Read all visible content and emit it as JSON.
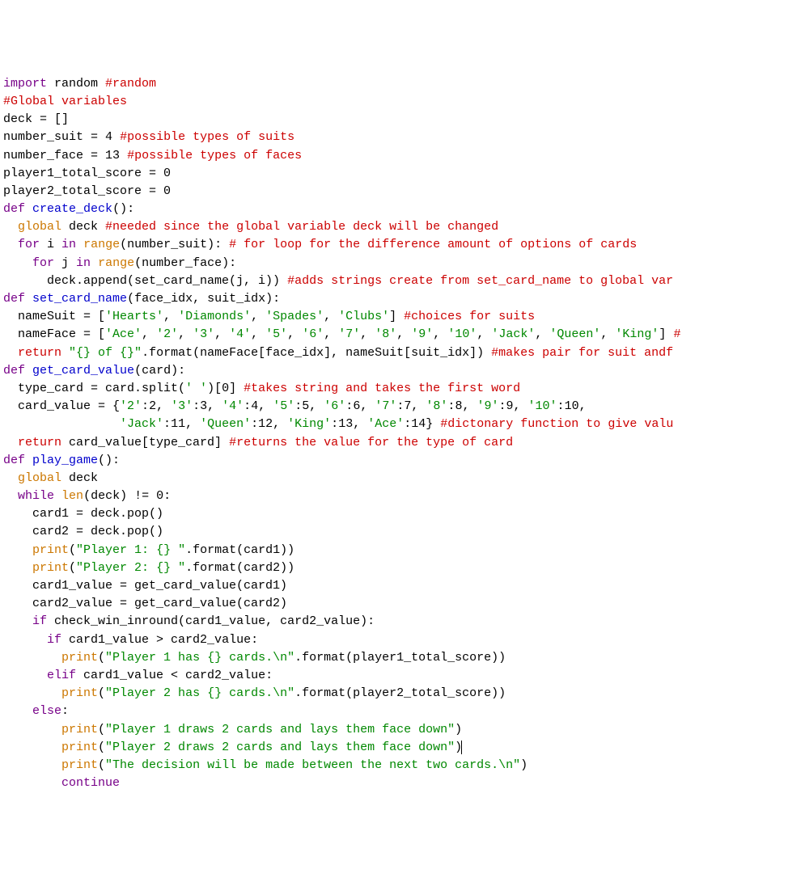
{
  "code_lines": [
    [
      [
        "import",
        "k"
      ],
      [
        " random ",
        "n"
      ],
      [
        "#random",
        "c"
      ]
    ],
    [
      [
        "#Global variables",
        "c"
      ]
    ],
    [
      [
        "deck = []",
        "n"
      ]
    ],
    [
      [
        "number_suit = ",
        "n"
      ],
      [
        "4",
        "num"
      ],
      [
        " ",
        "n"
      ],
      [
        "#possible types of suits",
        "c"
      ]
    ],
    [
      [
        "number_face = ",
        "n"
      ],
      [
        "13",
        "num"
      ],
      [
        " ",
        "n"
      ],
      [
        "#possible types of faces",
        "c"
      ]
    ],
    [
      [
        "player1_total_score = ",
        "n"
      ],
      [
        "0",
        "num"
      ]
    ],
    [
      [
        "player2_total_score = ",
        "n"
      ],
      [
        "0",
        "num"
      ]
    ],
    [
      [
        "",
        "n"
      ]
    ],
    [
      [
        "def",
        "kd"
      ],
      [
        " ",
        "n"
      ],
      [
        "create_deck",
        "fn"
      ],
      [
        "():",
        "n"
      ]
    ],
    [
      [
        "  ",
        "n"
      ],
      [
        "global",
        "bi"
      ],
      [
        " deck ",
        "n"
      ],
      [
        "#needed since the global variable deck will be changed",
        "c"
      ]
    ],
    [
      [
        "  ",
        "n"
      ],
      [
        "for",
        "k"
      ],
      [
        " i ",
        "n"
      ],
      [
        "in",
        "k"
      ],
      [
        " ",
        "n"
      ],
      [
        "range",
        "bi"
      ],
      [
        "(number_suit): ",
        "n"
      ],
      [
        "# for loop for the difference amount of options of cards",
        "c"
      ]
    ],
    [
      [
        "    ",
        "n"
      ],
      [
        "for",
        "k"
      ],
      [
        " j ",
        "n"
      ],
      [
        "in",
        "k"
      ],
      [
        " ",
        "n"
      ],
      [
        "range",
        "bi"
      ],
      [
        "(number_face):",
        "n"
      ]
    ],
    [
      [
        "      deck.append(set_card_name(j, i)) ",
        "n"
      ],
      [
        "#adds strings create from set_card_name to global var",
        "c"
      ]
    ],
    [
      [
        "",
        "n"
      ]
    ],
    [
      [
        "def",
        "kd"
      ],
      [
        " ",
        "n"
      ],
      [
        "set_card_name",
        "fn"
      ],
      [
        "(face_idx, suit_idx):",
        "n"
      ]
    ],
    [
      [
        "  nameSuit = [",
        "n"
      ],
      [
        "'Hearts'",
        "s"
      ],
      [
        ", ",
        "n"
      ],
      [
        "'Diamonds'",
        "s"
      ],
      [
        ", ",
        "n"
      ],
      [
        "'Spades'",
        "s"
      ],
      [
        ", ",
        "n"
      ],
      [
        "'Clubs'",
        "s"
      ],
      [
        "] ",
        "n"
      ],
      [
        "#choices for suits",
        "c"
      ]
    ],
    [
      [
        "  nameFace = [",
        "n"
      ],
      [
        "'Ace'",
        "s"
      ],
      [
        ", ",
        "n"
      ],
      [
        "'2'",
        "s"
      ],
      [
        ", ",
        "n"
      ],
      [
        "'3'",
        "s"
      ],
      [
        ", ",
        "n"
      ],
      [
        "'4'",
        "s"
      ],
      [
        ", ",
        "n"
      ],
      [
        "'5'",
        "s"
      ],
      [
        ", ",
        "n"
      ],
      [
        "'6'",
        "s"
      ],
      [
        ", ",
        "n"
      ],
      [
        "'7'",
        "s"
      ],
      [
        ", ",
        "n"
      ],
      [
        "'8'",
        "s"
      ],
      [
        ", ",
        "n"
      ],
      [
        "'9'",
        "s"
      ],
      [
        ", ",
        "n"
      ],
      [
        "'10'",
        "s"
      ],
      [
        ", ",
        "n"
      ],
      [
        "'Jack'",
        "s"
      ],
      [
        ", ",
        "n"
      ],
      [
        "'Queen'",
        "s"
      ],
      [
        ", ",
        "n"
      ],
      [
        "'King'",
        "s"
      ],
      [
        "] ",
        "n"
      ],
      [
        "#",
        "c"
      ]
    ],
    [
      [
        "  ",
        "n"
      ],
      [
        "return",
        "kr"
      ],
      [
        " ",
        "n"
      ],
      [
        "\"{} of {}\"",
        "s"
      ],
      [
        ".format(nameFace[face_idx], nameSuit[suit_idx]) ",
        "n"
      ],
      [
        "#makes pair for suit andf",
        "c"
      ]
    ],
    [
      [
        "",
        "n"
      ]
    ],
    [
      [
        "def",
        "kd"
      ],
      [
        " ",
        "n"
      ],
      [
        "get_card_value",
        "fn"
      ],
      [
        "(card):",
        "n"
      ]
    ],
    [
      [
        "  type_card = card.split(",
        "n"
      ],
      [
        "' '",
        "s"
      ],
      [
        ")[",
        "n"
      ],
      [
        "0",
        "num"
      ],
      [
        "] ",
        "n"
      ],
      [
        "#takes string and takes the first word",
        "c"
      ]
    ],
    [
      [
        "  card_value = {",
        "n"
      ],
      [
        "'2'",
        "s"
      ],
      [
        ":",
        "n"
      ],
      [
        "2",
        "num"
      ],
      [
        ", ",
        "n"
      ],
      [
        "'3'",
        "s"
      ],
      [
        ":",
        "n"
      ],
      [
        "3",
        "num"
      ],
      [
        ", ",
        "n"
      ],
      [
        "'4'",
        "s"
      ],
      [
        ":",
        "n"
      ],
      [
        "4",
        "num"
      ],
      [
        ", ",
        "n"
      ],
      [
        "'5'",
        "s"
      ],
      [
        ":",
        "n"
      ],
      [
        "5",
        "num"
      ],
      [
        ", ",
        "n"
      ],
      [
        "'6'",
        "s"
      ],
      [
        ":",
        "n"
      ],
      [
        "6",
        "num"
      ],
      [
        ", ",
        "n"
      ],
      [
        "'7'",
        "s"
      ],
      [
        ":",
        "n"
      ],
      [
        "7",
        "num"
      ],
      [
        ", ",
        "n"
      ],
      [
        "'8'",
        "s"
      ],
      [
        ":",
        "n"
      ],
      [
        "8",
        "num"
      ],
      [
        ", ",
        "n"
      ],
      [
        "'9'",
        "s"
      ],
      [
        ":",
        "n"
      ],
      [
        "9",
        "num"
      ],
      [
        ", ",
        "n"
      ],
      [
        "'10'",
        "s"
      ],
      [
        ":",
        "n"
      ],
      [
        "10",
        "num"
      ],
      [
        ",",
        "n"
      ]
    ],
    [
      [
        "                ",
        "n"
      ],
      [
        "'Jack'",
        "s"
      ],
      [
        ":",
        "n"
      ],
      [
        "11",
        "num"
      ],
      [
        ", ",
        "n"
      ],
      [
        "'Queen'",
        "s"
      ],
      [
        ":",
        "n"
      ],
      [
        "12",
        "num"
      ],
      [
        ", ",
        "n"
      ],
      [
        "'King'",
        "s"
      ],
      [
        ":",
        "n"
      ],
      [
        "13",
        "num"
      ],
      [
        ", ",
        "n"
      ],
      [
        "'Ace'",
        "s"
      ],
      [
        ":",
        "n"
      ],
      [
        "14",
        "num"
      ],
      [
        "} ",
        "n"
      ],
      [
        "#dictonary function to give valu",
        "c"
      ]
    ],
    [
      [
        "  ",
        "n"
      ],
      [
        "return",
        "kr"
      ],
      [
        " card_value[type_card] ",
        "n"
      ],
      [
        "#returns the value for the type of card",
        "c"
      ]
    ],
    [
      [
        "",
        "n"
      ]
    ],
    [
      [
        "def",
        "kd"
      ],
      [
        " ",
        "n"
      ],
      [
        "play_game",
        "fn"
      ],
      [
        "():",
        "n"
      ]
    ],
    [
      [
        "  ",
        "n"
      ],
      [
        "global",
        "bi"
      ],
      [
        " deck",
        "n"
      ]
    ],
    [
      [
        "  ",
        "n"
      ],
      [
        "while",
        "k"
      ],
      [
        " ",
        "n"
      ],
      [
        "len",
        "bi"
      ],
      [
        "(deck) != ",
        "n"
      ],
      [
        "0",
        "num"
      ],
      [
        ":",
        "n"
      ]
    ],
    [
      [
        "    card1 = deck.pop()",
        "n"
      ]
    ],
    [
      [
        "    card2 = deck.pop()",
        "n"
      ]
    ],
    [
      [
        "    ",
        "n"
      ],
      [
        "print",
        "bi"
      ],
      [
        "(",
        "n"
      ],
      [
        "\"Player 1: {} \"",
        "s"
      ],
      [
        ".format(card1))",
        "n"
      ]
    ],
    [
      [
        "    ",
        "n"
      ],
      [
        "print",
        "bi"
      ],
      [
        "(",
        "n"
      ],
      [
        "\"Player 2: {} \"",
        "s"
      ],
      [
        ".format(card2))",
        "n"
      ]
    ],
    [
      [
        "    card1_value = get_card_value(card1)",
        "n"
      ]
    ],
    [
      [
        "    card2_value = get_card_value(card2)",
        "n"
      ]
    ],
    [
      [
        "    ",
        "n"
      ],
      [
        "if",
        "k"
      ],
      [
        " check_win_inround(card1_value, card2_value):",
        "n"
      ]
    ],
    [
      [
        "      ",
        "n"
      ],
      [
        "if",
        "k"
      ],
      [
        " card1_value > card2_value:",
        "n"
      ]
    ],
    [
      [
        "        ",
        "n"
      ],
      [
        "print",
        "bi"
      ],
      [
        "(",
        "n"
      ],
      [
        "\"Player 1 has {} cards.\\n\"",
        "s"
      ],
      [
        ".format(player1_total_score))",
        "n"
      ]
    ],
    [
      [
        "      ",
        "n"
      ],
      [
        "elif",
        "k"
      ],
      [
        " card1_value < card2_value:",
        "n"
      ]
    ],
    [
      [
        "        ",
        "n"
      ],
      [
        "print",
        "bi"
      ],
      [
        "(",
        "n"
      ],
      [
        "\"Player 2 has {} cards.\\n\"",
        "s"
      ],
      [
        ".format(player2_total_score))",
        "n"
      ]
    ],
    [
      [
        "    ",
        "n"
      ],
      [
        "else",
        "k"
      ],
      [
        ":",
        "n"
      ]
    ],
    [
      [
        "        ",
        "n"
      ],
      [
        "print",
        "bi"
      ],
      [
        "(",
        "n"
      ],
      [
        "\"Player 1 draws 2 cards and lays them face down\"",
        "s"
      ],
      [
        ")",
        "n"
      ]
    ],
    [
      [
        "        ",
        "n"
      ],
      [
        "print",
        "bi"
      ],
      [
        "(",
        "n"
      ],
      [
        "\"Player 2 draws 2 cards and lays them face down\"",
        "s"
      ],
      [
        ")",
        "n"
      ],
      [
        "|",
        "cursor-mark"
      ]
    ],
    [
      [
        "        ",
        "n"
      ],
      [
        "print",
        "bi"
      ],
      [
        "(",
        "n"
      ],
      [
        "\"The decision will be made between the next two cards.\\n\"",
        "s"
      ],
      [
        ")",
        "n"
      ]
    ],
    [
      [
        "        ",
        "n"
      ],
      [
        "continue",
        "k"
      ]
    ]
  ]
}
